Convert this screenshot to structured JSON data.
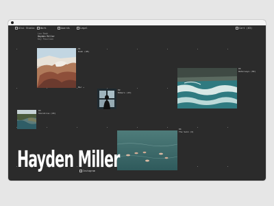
{
  "nav": {
    "studio": "Alsi Studio",
    "work": "Work",
    "awards": "Awards",
    "legal": "Legal",
    "cart": "Cart (03)"
  },
  "intro": {
    "line1": "Lou Bash",
    "name": "Hayden Miller",
    "line3": "Key Position"
  },
  "projects": [
    {
      "num": "01",
      "title": "Dusk (48)",
      "image_icon": "rock-landscape"
    },
    {
      "num": "02",
      "title": "Embers (23)",
      "image_icon": "window-silhouette"
    },
    {
      "num": "03",
      "title": "Shoreline (18)",
      "image_icon": "coast-aerial"
    },
    {
      "num": "04",
      "title": "The Swim (4)",
      "image_icon": "swimmers-sea"
    },
    {
      "num": "05",
      "title": "Waterways (09)",
      "image_icon": "rapids-river"
    }
  ],
  "side_label": "Mar →",
  "wordmark": "Hayden Miller",
  "instagram": "Instagram",
  "colors": {
    "background": "#2b2b2b",
    "text": "#ffffff",
    "muted": "#9a9a9a"
  }
}
